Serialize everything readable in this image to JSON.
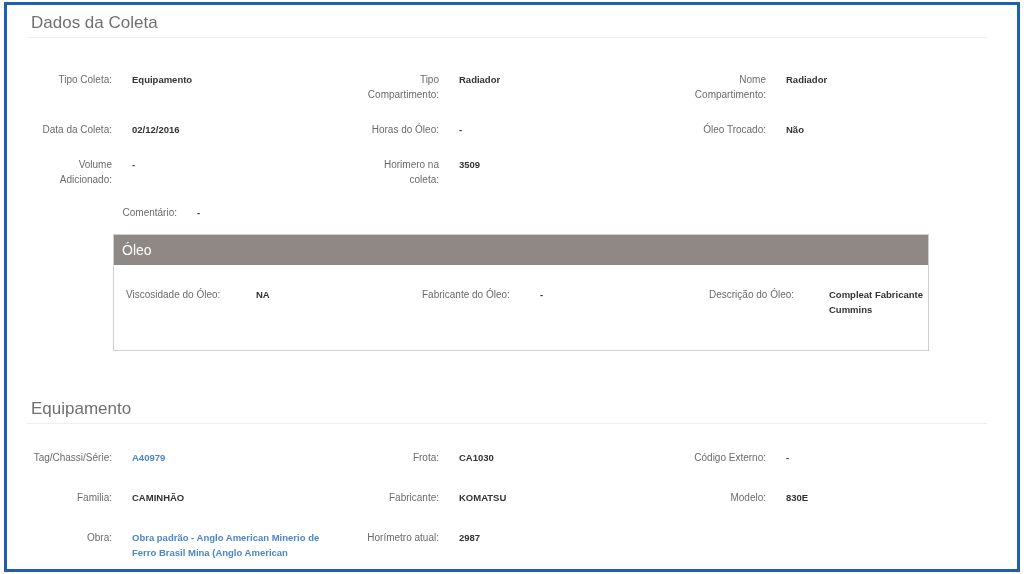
{
  "coleta": {
    "title": "Dados da Coleta",
    "fields": [
      {
        "label": "Tipo Coleta:",
        "value": "Equipamento"
      },
      {
        "label": "Tipo Compartimento:",
        "value": "Radiador"
      },
      {
        "label": "Nome Compartimento:",
        "value": "Radiador"
      },
      {
        "label": "Data da Coleta:",
        "value": "02/12/2016"
      },
      {
        "label": "Horas do Óleo:",
        "value": "-"
      },
      {
        "label": "Óleo Trocado:",
        "value": "Não"
      },
      {
        "label": "Volume Adicionado:",
        "value": "-"
      },
      {
        "label": "Horimero na coleta:",
        "value": "3509"
      }
    ],
    "comment": {
      "label": "Comentário:",
      "value": "-"
    },
    "oil_panel": {
      "title": "Óleo",
      "fields": [
        {
          "label": "Viscosidade do Óleo:",
          "value": "NA"
        },
        {
          "label": "Fabricante do Óleo:",
          "value": "-"
        },
        {
          "label": "Descrição do Óleo:",
          "value": "Compleat Fabricante Cummins"
        }
      ]
    }
  },
  "equipamento": {
    "title": "Equipamento",
    "fields": [
      {
        "label": "Tag/Chassi/Série:",
        "value": "A40979",
        "kind": "link"
      },
      {
        "label": "Frota:",
        "value": "CA1030",
        "kind": "text"
      },
      {
        "label": "Código Externo:",
        "value": "-",
        "kind": "text"
      },
      {
        "label": "Familia:",
        "value": "CAMINHÃO",
        "kind": "text"
      },
      {
        "label": "Fabricante:",
        "value": "KOMATSU",
        "kind": "text"
      },
      {
        "label": "Modelo:",
        "value": "830E",
        "kind": "text"
      },
      {
        "label": "Obra:",
        "value": "Obra padrão - Anglo American Minerio de Ferro Brasil Mina (Anglo American",
        "kind": "link"
      },
      {
        "label": "Horímetro atual:",
        "value": "2987",
        "kind": "text"
      }
    ]
  }
}
